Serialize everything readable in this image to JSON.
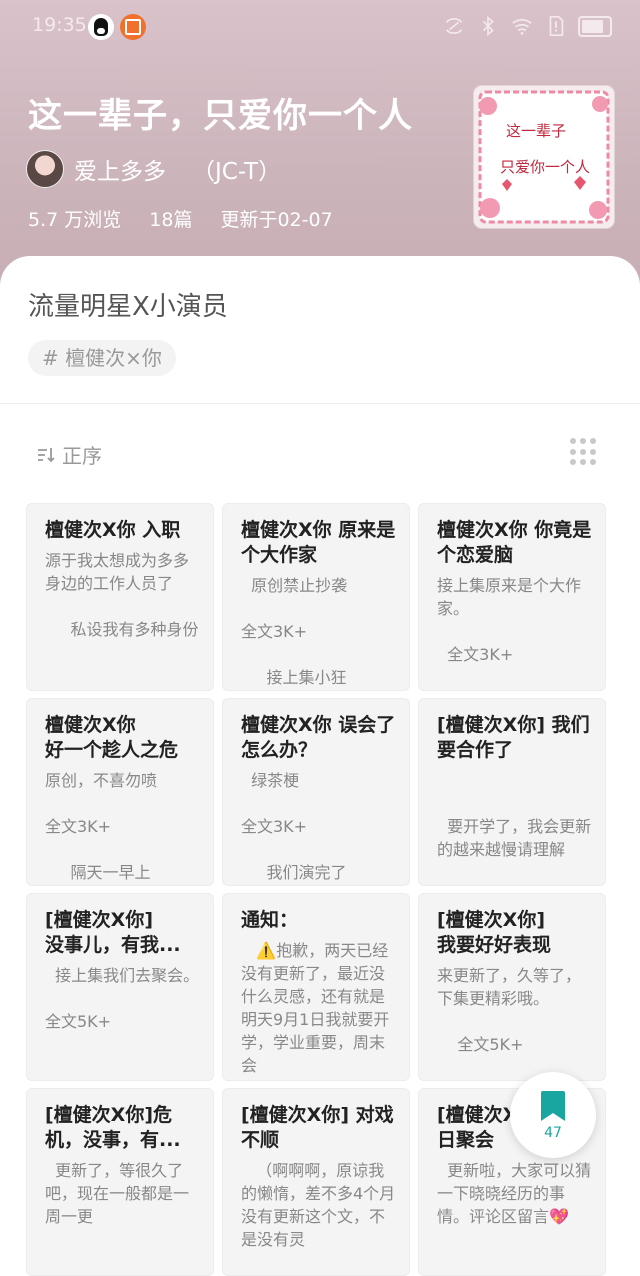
{
  "status_bar": {
    "time": "19:35",
    "icons": [
      "qq-icon",
      "app-notification-icon",
      "nfc-icon",
      "bluetooth-icon",
      "wifi-icon",
      "sim-alert-icon",
      "battery-icon"
    ]
  },
  "book": {
    "title": "这一辈子，只爱你一个人",
    "author": "爱上多多",
    "author_id": "（JC-T）",
    "views": "5.7 万浏览",
    "chapters_count": "18篇",
    "updated": "更新于02-07",
    "cover_text": [
      "这一辈子",
      "只爱你一个人"
    ],
    "subtitle": "流量明星X小演员",
    "tag": "# 檀健次×你"
  },
  "toolbar": {
    "sort_label": "正序"
  },
  "chapters": [
    {
      "title": "檀健次X你  入职",
      "body": "源于我太想成为多多身边的工作人员了\n\n     私设我有多种身份"
    },
    {
      "title": "檀健次X你   原来是个大作家",
      "body": "  原创禁止抄袭\n\n全文3K+\n\n     接上集小狂"
    },
    {
      "title": "檀健次X你   你竟是个恋爱脑",
      "body": "接上集原来是个大作家。\n\n  全文3K+"
    },
    {
      "title": "檀健次X你\n好一个趁人之危",
      "body": "原创，不喜勿喷\n\n全文3K+\n\n     隔天一早上"
    },
    {
      "title": "檀健次X你   误会了怎么办？",
      "body": "  绿茶梗\n\n全文3K+\n\n     我们演完了"
    },
    {
      "title": "[檀健次X你]  我们要合作了",
      "body": "\n\n  要开学了，我会更新的越来越慢请理解"
    },
    {
      "title": "[檀健次X你]\n没事儿，有我...",
      "body": "  接上集我们去聚会。\n\n全文5K+"
    },
    {
      "title": "通知：",
      "body": "   ⚠️抱歉，两天已经没有更新了，最近没什么灵感，还有就是明天9月1日我就要开学，学业重要，周末会"
    },
    {
      "title": "[檀健次X你]\n我要好好表现",
      "body": "来更新了，久等了，下集更精彩哦。\n\n    全文5K+"
    },
    {
      "title": "[檀健次X你]危机，没事，有...",
      "body": "  更新了，等很久了吧，现在一般都是一周一更"
    },
    {
      "title": "[檀健次X你]  对戏不顺",
      "body": "   （啊啊啊，原谅我的懒惰，差不多4个月没有更新这个文，不是没有灵"
    },
    {
      "title": "[檀健次X你]\n日聚会",
      "body": "  更新啦，大家可以猜一下晓晓经历的事情。评论区留言💖"
    }
  ],
  "fab": {
    "icon": "bookmark-icon",
    "count": "47"
  },
  "colors": {
    "header_bg": "#cfb6bd",
    "accent": "#1aa6a0",
    "card_bg": "#f4f4f4"
  }
}
